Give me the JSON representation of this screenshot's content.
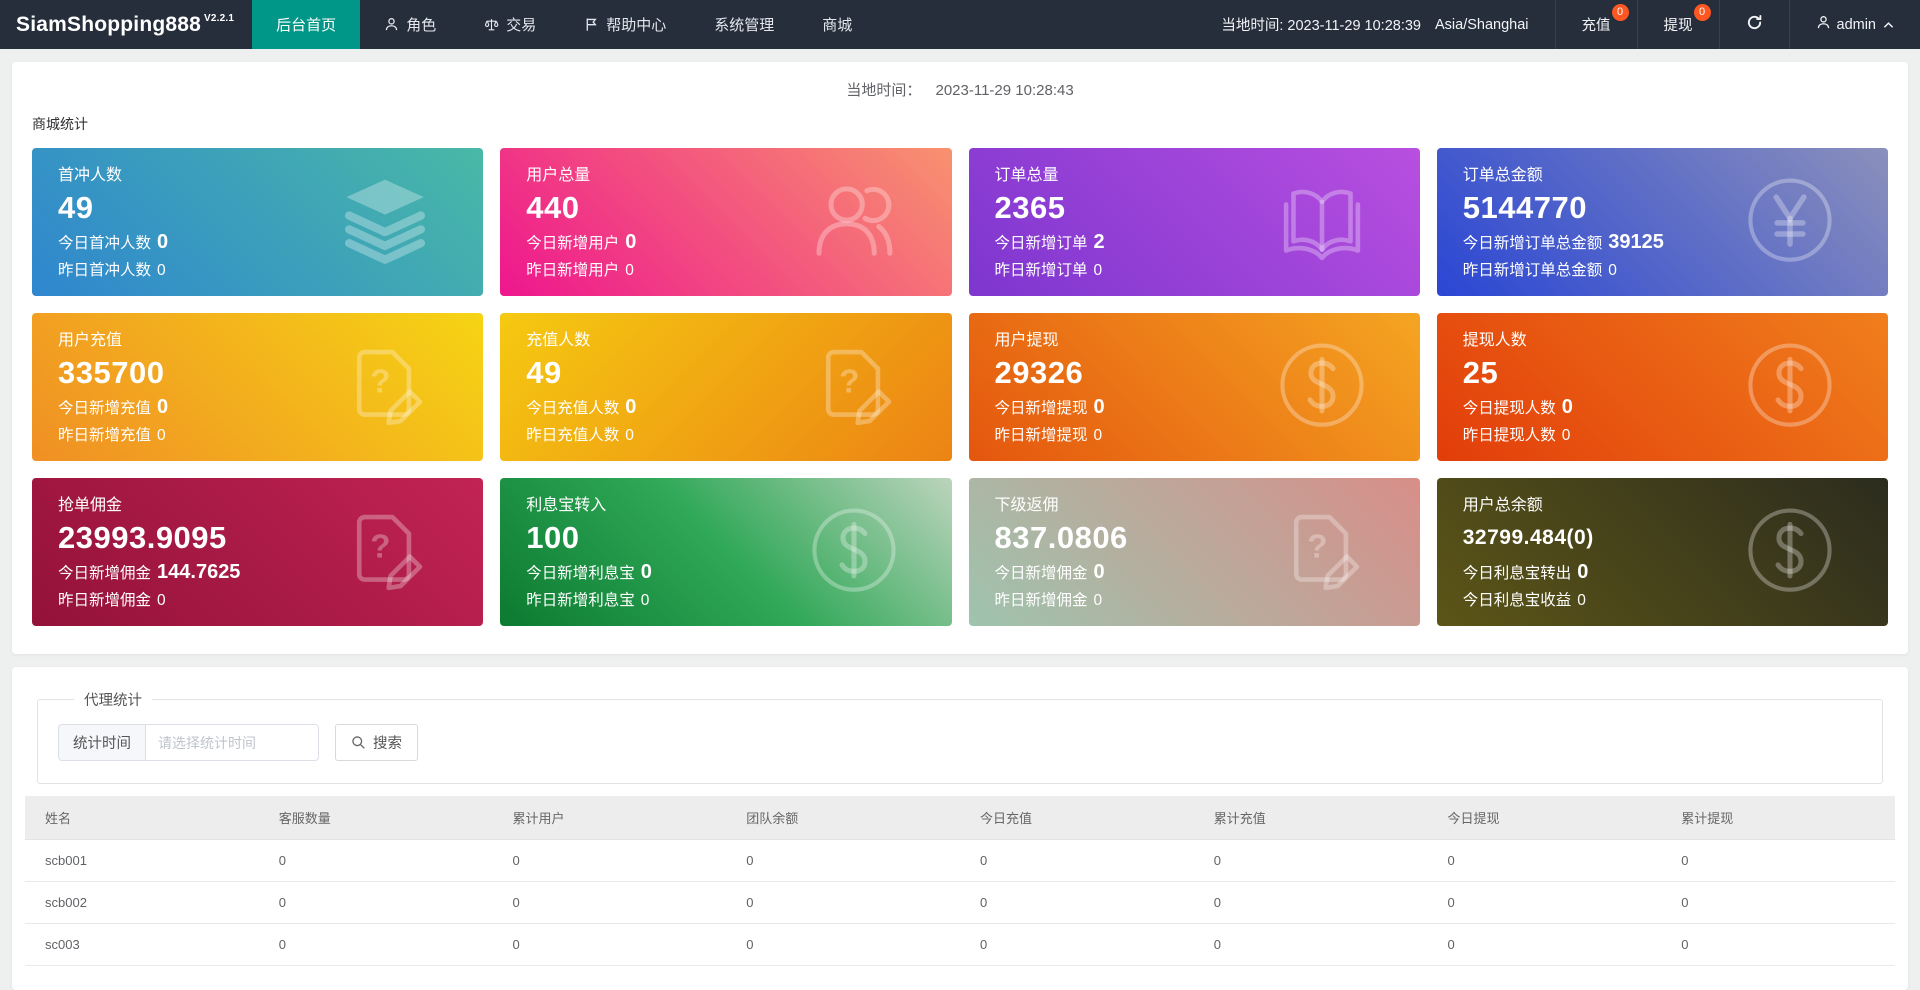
{
  "theme": {
    "accent": "#009688",
    "badge": "#ff5722",
    "navbar_bg": "#262e3c"
  },
  "navbar": {
    "brand": "SiamShopping888",
    "version": "V2.2.1",
    "menu": [
      {
        "label": "后台首页",
        "icon": "",
        "active": true
      },
      {
        "label": "角色",
        "icon": "user"
      },
      {
        "label": "交易",
        "icon": "scale"
      },
      {
        "label": "帮助中心",
        "icon": "flag"
      },
      {
        "label": "系统管理",
        "icon": ""
      },
      {
        "label": "商城",
        "icon": ""
      }
    ],
    "local_time": "当地时间: 2023-11-29 10:28:39",
    "timezone": "Asia/Shanghai",
    "recharge_label": "充值",
    "recharge_badge": "0",
    "withdraw_label": "提现",
    "withdraw_badge": "0",
    "username": "admin"
  },
  "overview": {
    "local_time_label": "当地时间：",
    "local_time_value": "2023-11-29 10:28:43",
    "section_title": "商城统计",
    "cards": [
      {
        "title": "首冲人数",
        "value": "49",
        "line2_label": "今日首冲人数",
        "line2_value": "0",
        "line3_label": "昨日首冲人数",
        "line3_value": "0",
        "icon": "layers",
        "colors": [
          "#2f86cf",
          "#49b9a6"
        ]
      },
      {
        "title": "用户总量",
        "value": "440",
        "line2_label": "今日新增用户",
        "line2_value": "0",
        "line3_label": "昨日新增用户",
        "line3_value": "0",
        "icon": "users",
        "colors": [
          "#ee168e",
          "#f8926f"
        ]
      },
      {
        "title": "订单总量",
        "value": "2365",
        "line2_label": "今日新增订单",
        "line2_value": "2",
        "line3_label": "昨日新增订单",
        "line3_value": "0",
        "icon": "book",
        "colors": [
          "#7d36cf",
          "#b84fe0"
        ]
      },
      {
        "title": "订单总金额",
        "value": "5144770",
        "line2_label": "今日新增订单总金额",
        "line2_value": "39125",
        "line3_label": "昨日新增订单总金额",
        "line3_value": "0",
        "icon": "yen",
        "colors": [
          "#2a46d4",
          "#8b90bb"
        ]
      },
      {
        "title": "用户充值",
        "value": "335700",
        "line2_label": "今日新增充值",
        "line2_value": "0",
        "line3_label": "昨日新增充值",
        "line3_value": "0",
        "icon": "edit",
        "colors": [
          "#f08f25",
          "#f6d414"
        ]
      },
      {
        "title": "充值人数",
        "value": "49",
        "line2_label": "今日充值人数",
        "line2_value": "0",
        "line3_label": "昨日充值人数",
        "line3_value": "0",
        "icon": "edit",
        "colors": [
          "#f5c911",
          "#ec8314"
        ],
        "angle": 135
      },
      {
        "title": "用户提现",
        "value": "29326",
        "line2_label": "今日新增提现",
        "line2_value": "0",
        "line3_label": "昨日新增提现",
        "line3_value": "0",
        "icon": "dollar",
        "colors": [
          "#e4560e",
          "#f5a522"
        ]
      },
      {
        "title": "提现人数",
        "value": "25",
        "line2_label": "今日提现人数",
        "line2_value": "0",
        "line3_label": "昨日提现人数",
        "line3_value": "0",
        "icon": "dollar",
        "colors": [
          "#e23d0a",
          "#f07f1c"
        ]
      },
      {
        "title": "抢单佣金",
        "value": "23993.9095",
        "line2_label": "今日新增佣金",
        "line2_value": "144.7625",
        "line3_label": "昨日新增佣金",
        "line3_value": "0",
        "icon": "edit",
        "colors": [
          "#93123a",
          "#c22355"
        ]
      },
      {
        "title": "利息宝转入",
        "value": "100",
        "line2_label": "今日新增利息宝",
        "line2_value": "0",
        "line3_label": "昨日新增利息宝",
        "line3_value": "0",
        "icon": "dollar",
        "colors": [
          "#0c7a30",
          "#2fa857",
          "#bcd4bd"
        ]
      },
      {
        "title": "下级返佣",
        "value": "837.0806",
        "line2_label": "今日新增佣金",
        "line2_value": "0",
        "line3_label": "昨日新增佣金",
        "line3_value": "0",
        "icon": "edit",
        "colors": [
          "#9ec4ae",
          "#d88e89"
        ]
      },
      {
        "title": "用户总余额",
        "value": "32799.484(0)",
        "line2_label": "今日利息宝转出",
        "line2_value": "0",
        "line3_label": "今日利息宝收益",
        "line3_value": "0",
        "icon": "dollar",
        "colors": [
          "#5c5517",
          "#2c2c1e"
        ],
        "value_small": true
      }
    ]
  },
  "agent_stats": {
    "legend": "代理统计",
    "time_label": "统计时间",
    "time_placeholder": "请选择统计时间",
    "search_label": "搜索",
    "table": {
      "columns": [
        "姓名",
        "客服数量",
        "累计用户",
        "团队余额",
        "今日充值",
        "累计充值",
        "今日提现",
        "累计提现"
      ],
      "rows": [
        [
          "scb001",
          "0",
          "0",
          "0",
          "0",
          "0",
          "0",
          "0"
        ],
        [
          "scb002",
          "0",
          "0",
          "0",
          "0",
          "0",
          "0",
          "0"
        ],
        [
          "sc003",
          "0",
          "0",
          "0",
          "0",
          "0",
          "0",
          "0"
        ]
      ]
    }
  }
}
